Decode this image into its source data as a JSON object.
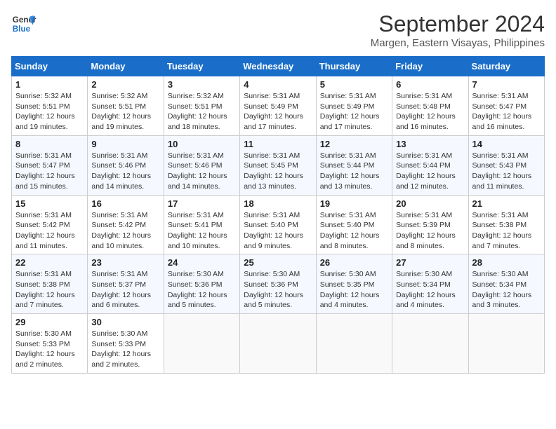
{
  "header": {
    "logo_line1": "General",
    "logo_line2": "Blue",
    "month": "September 2024",
    "location": "Margen, Eastern Visayas, Philippines"
  },
  "weekdays": [
    "Sunday",
    "Monday",
    "Tuesday",
    "Wednesday",
    "Thursday",
    "Friday",
    "Saturday"
  ],
  "weeks": [
    [
      {
        "day": "1",
        "sunrise": "5:32 AM",
        "sunset": "5:51 PM",
        "daylight": "12 hours and 19 minutes."
      },
      {
        "day": "2",
        "sunrise": "5:32 AM",
        "sunset": "5:51 PM",
        "daylight": "12 hours and 19 minutes."
      },
      {
        "day": "3",
        "sunrise": "5:32 AM",
        "sunset": "5:51 PM",
        "daylight": "12 hours and 18 minutes."
      },
      {
        "day": "4",
        "sunrise": "5:31 AM",
        "sunset": "5:49 PM",
        "daylight": "12 hours and 17 minutes."
      },
      {
        "day": "5",
        "sunrise": "5:31 AM",
        "sunset": "5:49 PM",
        "daylight": "12 hours and 17 minutes."
      },
      {
        "day": "6",
        "sunrise": "5:31 AM",
        "sunset": "5:48 PM",
        "daylight": "12 hours and 16 minutes."
      },
      {
        "day": "7",
        "sunrise": "5:31 AM",
        "sunset": "5:47 PM",
        "daylight": "12 hours and 16 minutes."
      }
    ],
    [
      {
        "day": "8",
        "sunrise": "5:31 AM",
        "sunset": "5:47 PM",
        "daylight": "12 hours and 15 minutes."
      },
      {
        "day": "9",
        "sunrise": "5:31 AM",
        "sunset": "5:46 PM",
        "daylight": "12 hours and 14 minutes."
      },
      {
        "day": "10",
        "sunrise": "5:31 AM",
        "sunset": "5:46 PM",
        "daylight": "12 hours and 14 minutes."
      },
      {
        "day": "11",
        "sunrise": "5:31 AM",
        "sunset": "5:45 PM",
        "daylight": "12 hours and 13 minutes."
      },
      {
        "day": "12",
        "sunrise": "5:31 AM",
        "sunset": "5:44 PM",
        "daylight": "12 hours and 13 minutes."
      },
      {
        "day": "13",
        "sunrise": "5:31 AM",
        "sunset": "5:44 PM",
        "daylight": "12 hours and 12 minutes."
      },
      {
        "day": "14",
        "sunrise": "5:31 AM",
        "sunset": "5:43 PM",
        "daylight": "12 hours and 11 minutes."
      }
    ],
    [
      {
        "day": "15",
        "sunrise": "5:31 AM",
        "sunset": "5:42 PM",
        "daylight": "12 hours and 11 minutes."
      },
      {
        "day": "16",
        "sunrise": "5:31 AM",
        "sunset": "5:42 PM",
        "daylight": "12 hours and 10 minutes."
      },
      {
        "day": "17",
        "sunrise": "5:31 AM",
        "sunset": "5:41 PM",
        "daylight": "12 hours and 10 minutes."
      },
      {
        "day": "18",
        "sunrise": "5:31 AM",
        "sunset": "5:40 PM",
        "daylight": "12 hours and 9 minutes."
      },
      {
        "day": "19",
        "sunrise": "5:31 AM",
        "sunset": "5:40 PM",
        "daylight": "12 hours and 8 minutes."
      },
      {
        "day": "20",
        "sunrise": "5:31 AM",
        "sunset": "5:39 PM",
        "daylight": "12 hours and 8 minutes."
      },
      {
        "day": "21",
        "sunrise": "5:31 AM",
        "sunset": "5:38 PM",
        "daylight": "12 hours and 7 minutes."
      }
    ],
    [
      {
        "day": "22",
        "sunrise": "5:31 AM",
        "sunset": "5:38 PM",
        "daylight": "12 hours and 7 minutes."
      },
      {
        "day": "23",
        "sunrise": "5:31 AM",
        "sunset": "5:37 PM",
        "daylight": "12 hours and 6 minutes."
      },
      {
        "day": "24",
        "sunrise": "5:30 AM",
        "sunset": "5:36 PM",
        "daylight": "12 hours and 5 minutes."
      },
      {
        "day": "25",
        "sunrise": "5:30 AM",
        "sunset": "5:36 PM",
        "daylight": "12 hours and 5 minutes."
      },
      {
        "day": "26",
        "sunrise": "5:30 AM",
        "sunset": "5:35 PM",
        "daylight": "12 hours and 4 minutes."
      },
      {
        "day": "27",
        "sunrise": "5:30 AM",
        "sunset": "5:34 PM",
        "daylight": "12 hours and 4 minutes."
      },
      {
        "day": "28",
        "sunrise": "5:30 AM",
        "sunset": "5:34 PM",
        "daylight": "12 hours and 3 minutes."
      }
    ],
    [
      {
        "day": "29",
        "sunrise": "5:30 AM",
        "sunset": "5:33 PM",
        "daylight": "12 hours and 2 minutes."
      },
      {
        "day": "30",
        "sunrise": "5:30 AM",
        "sunset": "5:33 PM",
        "daylight": "12 hours and 2 minutes."
      },
      null,
      null,
      null,
      null,
      null
    ]
  ],
  "labels": {
    "sunrise": "Sunrise:",
    "sunset": "Sunset:",
    "daylight": "Daylight:"
  }
}
